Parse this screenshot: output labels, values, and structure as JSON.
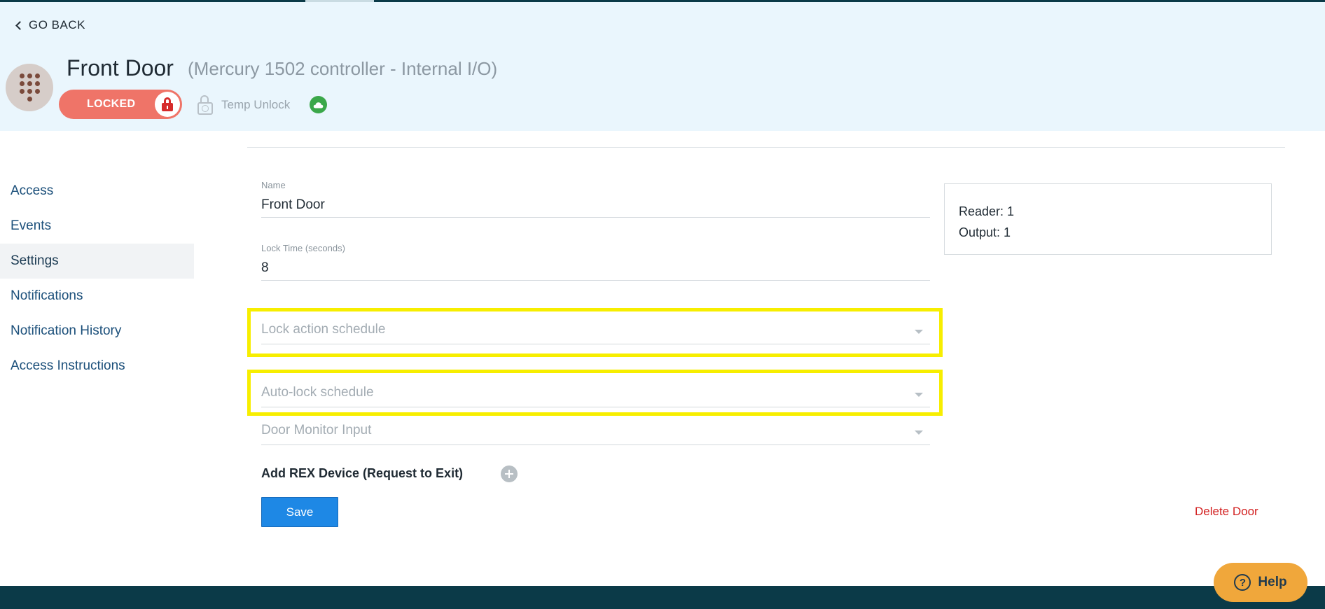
{
  "header": {
    "go_back": "GO BACK",
    "title": "Front Door",
    "subtitle": "(Mercury 1502 controller - Internal I/O)",
    "lock_status": "LOCKED",
    "temp_unlock": "Temp Unlock",
    "avatar_icon": "keypad-icon",
    "cloud_icon": "cloud-icon",
    "colors": {
      "locked": "#ef7468",
      "online": "#3ba84a",
      "header_bg": "#eaf6fd"
    }
  },
  "sidebar": {
    "active": "Settings",
    "items": [
      {
        "label": "Access"
      },
      {
        "label": "Events"
      },
      {
        "label": "Settings"
      },
      {
        "label": "Notifications"
      },
      {
        "label": "Notification History"
      },
      {
        "label": "Access Instructions"
      }
    ]
  },
  "form": {
    "name": {
      "label": "Name",
      "value": "Front Door"
    },
    "lock_time": {
      "label": "Lock Time (seconds)",
      "value": "8"
    },
    "lock_action_schedule": {
      "placeholder": "Lock action schedule"
    },
    "auto_lock_schedule": {
      "placeholder": "Auto-lock schedule"
    },
    "door_monitor_input": {
      "placeholder": "Door Monitor Input"
    },
    "add_rex": "Add REX Device (Request to Exit)",
    "save": "Save",
    "delete": "Delete Door"
  },
  "info": {
    "reader": "Reader: 1",
    "output": "Output: 1"
  },
  "help": {
    "label": "Help",
    "icon": "question-icon",
    "glyph": "?"
  },
  "highlight_color": "#f7ee00"
}
